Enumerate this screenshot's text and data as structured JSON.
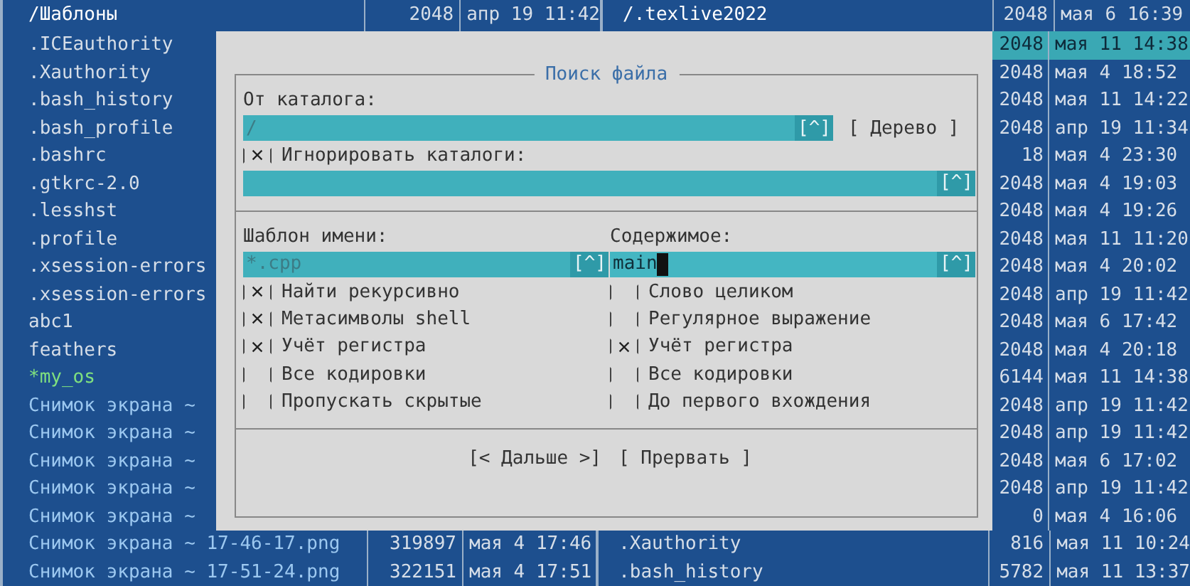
{
  "left_panel": {
    "header": {
      "name": "/Шаблоны",
      "size": "2048",
      "date": "апр 19 11:42"
    },
    "rows": [
      {
        "name": ".ICEauthority",
        "kind": "file"
      },
      {
        "name": ".Xauthority",
        "kind": "file"
      },
      {
        "name": ".bash_history",
        "kind": "file"
      },
      {
        "name": ".bash_profile",
        "kind": "file"
      },
      {
        "name": ".bashrc",
        "kind": "file"
      },
      {
        "name": ".gtkrc-2.0",
        "kind": "file"
      },
      {
        "name": ".lesshst",
        "kind": "file"
      },
      {
        "name": ".profile",
        "kind": "file"
      },
      {
        "name": ".xsession-errors",
        "kind": "file"
      },
      {
        "name": ".xsession-errors",
        "kind": "file"
      },
      {
        "name": "abc1",
        "kind": "file"
      },
      {
        "name": "feathers",
        "kind": "file"
      },
      {
        "name": "*my_os",
        "kind": "exec"
      },
      {
        "name": "Снимок экрана ~",
        "kind": "image"
      },
      {
        "name": "Снимок экрана ~",
        "kind": "image"
      },
      {
        "name": "Снимок экрана ~",
        "kind": "image"
      },
      {
        "name": "Снимок экрана ~",
        "kind": "image"
      },
      {
        "name": "Снимок экрана ~",
        "kind": "image"
      }
    ],
    "bottom_rows": [
      {
        "name": "Снимок экрана ~ 17-46-17.png",
        "size": "319897",
        "date": "мая 4 17:46",
        "kind": "image"
      },
      {
        "name": "Снимок экрана ~ 17-51-24.png",
        "size": "322151",
        "date": "мая 4 17:51",
        "kind": "image"
      }
    ]
  },
  "right_panel": {
    "header": {
      "name": "/.texlive2022",
      "size": "2048",
      "date": "мая 6 16:39"
    },
    "rows": [
      {
        "size": "2048",
        "date": "мая 11 14:38",
        "selected": true
      },
      {
        "size": "2048",
        "date": "мая 4 18:52",
        "selected": false
      },
      {
        "size": "2048",
        "date": "мая 11 14:22",
        "selected": false
      },
      {
        "size": "2048",
        "date": "апр 19 11:34",
        "selected": false
      },
      {
        "size": "18",
        "date": "мая 4 23:30",
        "selected": false
      },
      {
        "size": "2048",
        "date": "мая 4 19:03",
        "selected": false
      },
      {
        "size": "2048",
        "date": "мая 4 19:26",
        "selected": false
      },
      {
        "size": "2048",
        "date": "мая 11 11:20",
        "selected": false
      },
      {
        "size": "2048",
        "date": "мая 4 20:02",
        "selected": false
      },
      {
        "size": "2048",
        "date": "апр 19 11:42",
        "selected": false
      },
      {
        "size": "2048",
        "date": "мая 6 17:42",
        "selected": false
      },
      {
        "size": "2048",
        "date": "мая 4 20:18",
        "selected": false
      },
      {
        "size": "6144",
        "date": "мая 11 14:38",
        "selected": false
      },
      {
        "size": "2048",
        "date": "апр 19 11:42",
        "selected": false
      },
      {
        "size": "2048",
        "date": "апр 19 11:42",
        "selected": false
      },
      {
        "size": "2048",
        "date": "мая 6 17:02",
        "selected": false
      },
      {
        "size": "2048",
        "date": "апр 19 11:42",
        "selected": false
      },
      {
        "size": "0",
        "date": "мая 4 16:06",
        "selected": false
      }
    ],
    "bottom_rows": [
      {
        "name": ".Xauthority",
        "size": "816",
        "date": "мая 11 10:24",
        "kind": "file"
      },
      {
        "name": ".bash_history",
        "size": "5782",
        "date": "мая 11 13:37",
        "kind": "file"
      }
    ]
  },
  "dialog": {
    "title": "Поиск файла",
    "from_dir": {
      "label": "От каталога:",
      "value": "/",
      "history": "[^]",
      "focused": false
    },
    "tree_button": "[ Дерево ]",
    "ignore_dirs": {
      "label": "Игнорировать каталоги:",
      "checked": true,
      "history": "[^]"
    },
    "name_pattern": {
      "label": "Шаблон имени:",
      "value": "*.cpp",
      "history": "[^]",
      "focused": false
    },
    "content": {
      "label": "Содержимое:",
      "value": "main",
      "history": "[^]",
      "focused": true
    },
    "left_options": [
      {
        "label": "Найти рекурсивно",
        "checked": true
      },
      {
        "label": "Метасимволы shell",
        "checked": true
      },
      {
        "label": "Учёт регистра",
        "checked": true
      },
      {
        "label": "Все кодировки",
        "checked": false
      },
      {
        "label": "Пропускать скрытые",
        "checked": false
      }
    ],
    "right_options": [
      {
        "label": "Слово целиком",
        "checked": false
      },
      {
        "label": "Регулярное выражение",
        "checked": false
      },
      {
        "label": "Учёт регистра",
        "checked": true
      },
      {
        "label": "Все кодировки",
        "checked": false
      },
      {
        "label": "До первого вхождения",
        "checked": false
      }
    ],
    "buttons": [
      "[< Дальше >]",
      "[ Прервать ]"
    ]
  }
}
